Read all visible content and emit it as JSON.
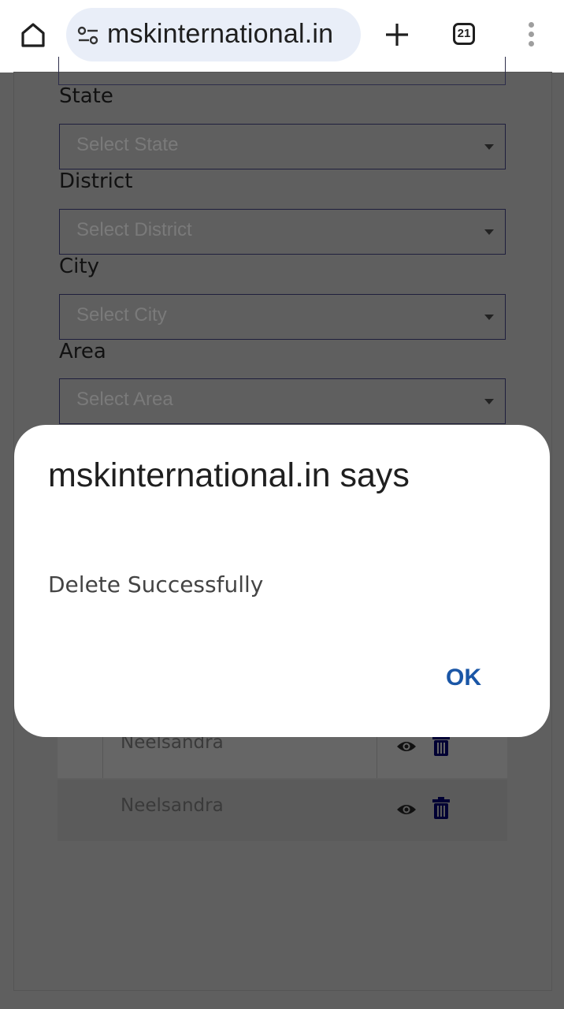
{
  "browser": {
    "url": "mskinternational.in",
    "tab_count": "21"
  },
  "form": {
    "state_label": "State",
    "state_placeholder": "Select State",
    "district_label": "District",
    "district_placeholder": "Select District",
    "city_label": "City",
    "city_placeholder": "Select City",
    "area_label": "Area",
    "area_placeholder": "Select Area"
  },
  "table": {
    "rows": [
      {
        "name": "Neelsandra"
      },
      {
        "name": "Neelsandra"
      }
    ]
  },
  "dialog": {
    "title": "mskinternational.in says",
    "message": "Delete Successfully",
    "ok_label": "OK"
  },
  "colors": {
    "overlay": "#5f5f5f",
    "accent": "#1a56a6",
    "icon": "#000033"
  }
}
